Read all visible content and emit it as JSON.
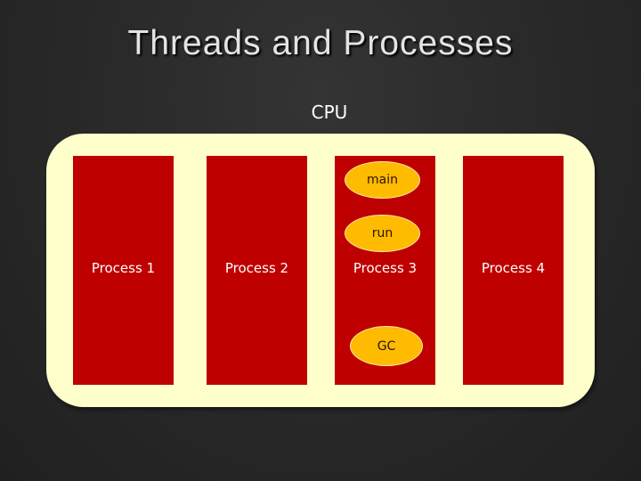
{
  "slide": {
    "title": "Threads and Processes"
  },
  "cpu": {
    "label": "CPU",
    "colors": {
      "container": "#ffffcc",
      "process": "#bf0000",
      "thread": "#ffbb00"
    }
  },
  "processes": [
    {
      "label": "Process 1",
      "threads": []
    },
    {
      "label": "Process 2",
      "threads": []
    },
    {
      "label": "Process 3",
      "threads": [
        "main",
        "run",
        "GC"
      ]
    },
    {
      "label": "Process 4",
      "threads": []
    }
  ]
}
